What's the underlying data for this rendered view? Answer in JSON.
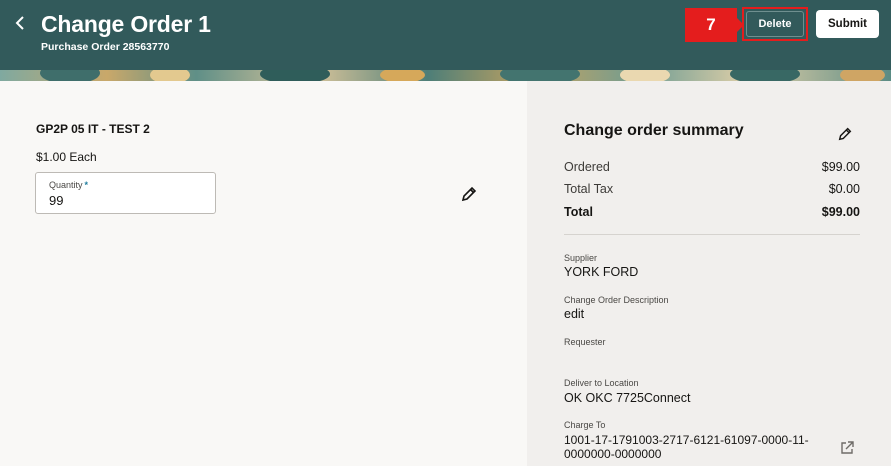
{
  "header": {
    "title": "Change Order 1",
    "subtitle": "Purchase Order 28563770",
    "step_number": "7",
    "delete_label": "Delete",
    "submit_label": "Submit",
    "back_icon": "chevron-left-icon"
  },
  "line": {
    "item_name": "GP2P 05 IT - TEST 2",
    "price": "$1.00 Each",
    "quantity_label": "Quantity",
    "quantity_required": "*",
    "quantity_value": "99",
    "edit_icon": "pencil-icon"
  },
  "summary": {
    "title": "Change order summary",
    "edit_icon": "pencil-icon",
    "ordered_label": "Ordered",
    "ordered_value": "$99.00",
    "tax_label": "Total Tax",
    "tax_value": "$0.00",
    "total_label": "Total",
    "total_value": "$99.00",
    "supplier_label": "Supplier",
    "supplier_value": "YORK FORD",
    "description_label": "Change Order Description",
    "description_value": "edit",
    "requester_label": "Requester",
    "deliver_label": "Deliver to Location",
    "deliver_value": "OK OKC 7725Connect",
    "charge_label": "Charge To",
    "charge_value": "1001-17-1791003-2717-6121-61097-0000-11-0000000-0000000",
    "external_link_icon": "external-link-icon"
  },
  "colors": {
    "header_bg": "#325a5b",
    "highlight": "#e41d1d",
    "panel_bg": "#f1efed"
  }
}
